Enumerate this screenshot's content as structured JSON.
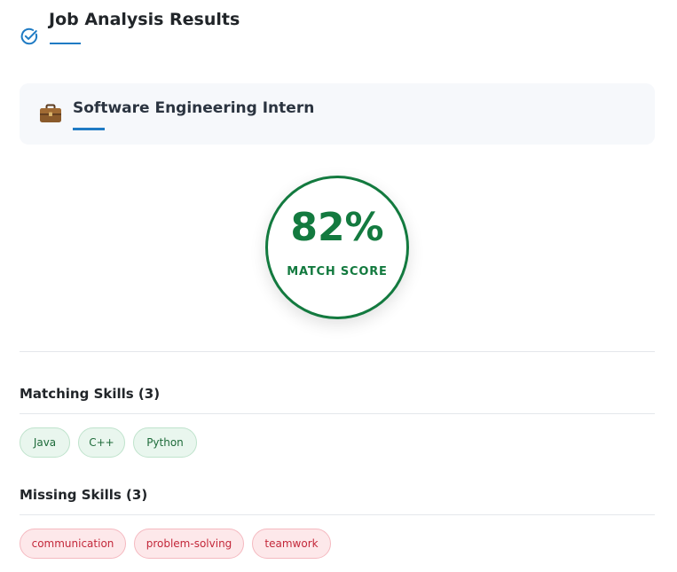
{
  "header": {
    "title": "Job Analysis Results",
    "icon": "check-circle-icon",
    "accent_color": "#1f7bc4"
  },
  "job": {
    "title": "Software Engineering Intern",
    "icon": "briefcase-icon",
    "card_background": "#f6f8fb"
  },
  "score": {
    "value": "82%",
    "percent": 82,
    "label": "MATCH SCORE",
    "color": "#137a3f"
  },
  "matching": {
    "title": "Matching Skills (3)",
    "skills": [
      "Java",
      "C++",
      "Python"
    ],
    "chip_color": "#1e6b3a",
    "chip_background": "#e9f6ee"
  },
  "missing": {
    "title": "Missing Skills (3)",
    "skills": [
      "communication",
      "problem-solving",
      "teamwork"
    ],
    "chip_color": "#c3283a",
    "chip_background": "#fde8ea"
  }
}
